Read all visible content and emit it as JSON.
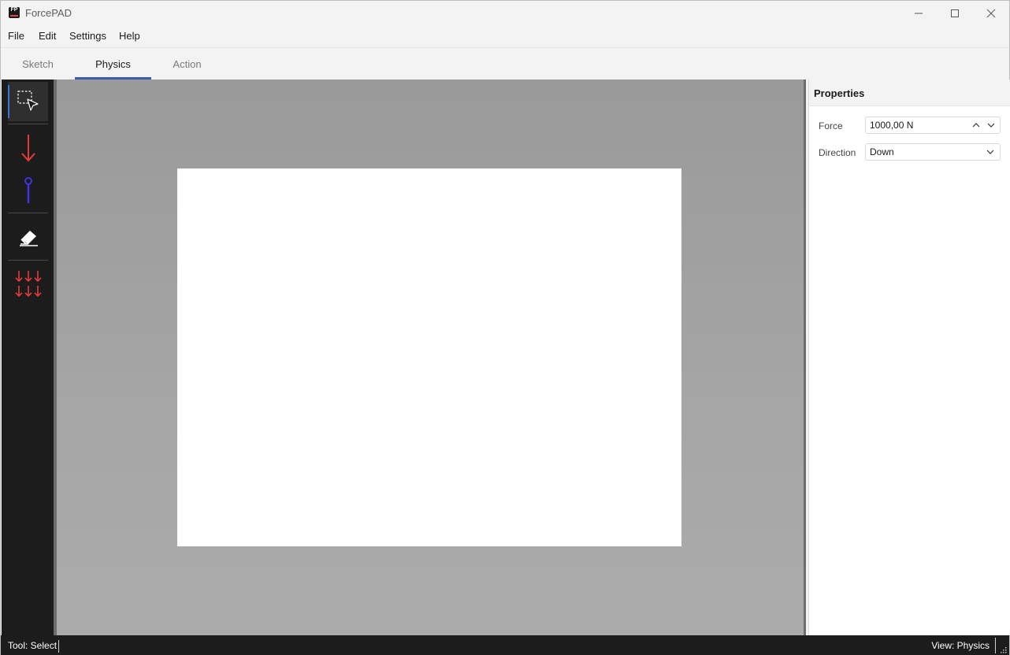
{
  "window": {
    "title": "ForcePAD",
    "app_icon_text": "FP",
    "controls": [
      "minimize-icon",
      "maximize-icon",
      "close-icon"
    ]
  },
  "menu": {
    "items": [
      "File",
      "Edit",
      "Settings",
      "Help"
    ]
  },
  "tabs": {
    "items": [
      "Sketch",
      "Physics",
      "Action"
    ],
    "active": "Physics"
  },
  "tools": [
    {
      "name": "select-tool",
      "icon": "select-cursor-icon",
      "selected": true
    },
    {
      "name": "force-tool",
      "icon": "force-arrow-icon",
      "color": "#e63a3a"
    },
    {
      "name": "constraint-tool",
      "icon": "pin-constraint-icon",
      "color": "#3f35e0"
    },
    {
      "name": "eraser-tool",
      "icon": "eraser-icon",
      "color": "#ffffff"
    },
    {
      "name": "distributed-load-tool",
      "icon": "distributed-load-icon",
      "color": "#e63a3a"
    }
  ],
  "properties": {
    "title": "Properties",
    "force_label": "Force",
    "force_value": "1000,00 N",
    "direction_label": "Direction",
    "direction_value": "Down"
  },
  "status": {
    "tool": "Tool: Select",
    "view": "View: Physics"
  },
  "colors": {
    "accent": "#3e5ca8",
    "force": "#e63a3a",
    "constraint": "#3f35e0",
    "toolbar_bg": "#1c1c1c"
  }
}
